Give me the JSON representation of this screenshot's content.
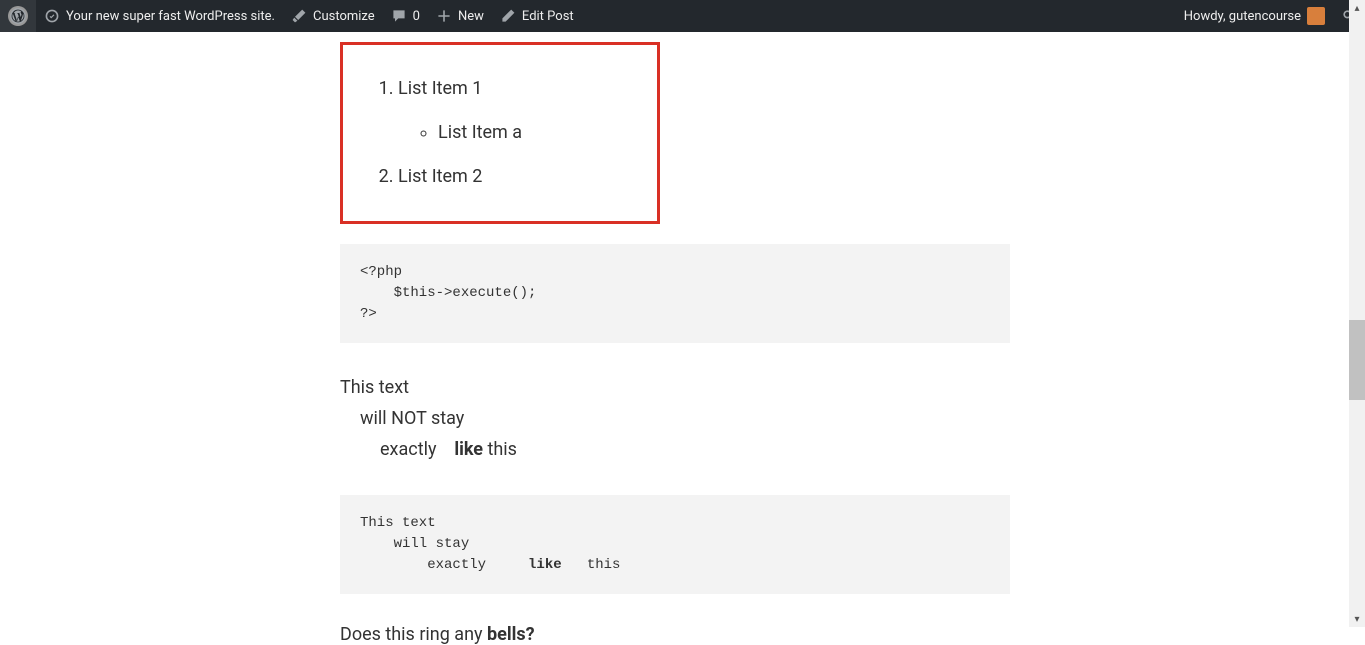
{
  "adminBar": {
    "siteName": "Your new super fast WordPress site.",
    "customize": "Customize",
    "commentsCount": "0",
    "new": "New",
    "editPost": "Edit Post",
    "greeting": "Howdy, gutencourse"
  },
  "content": {
    "list": {
      "item1": "List Item 1",
      "itemA": "List Item a",
      "item2": "List Item 2"
    },
    "codeBlock": "<?php\n    $this->execute();\n?>",
    "textBlock": {
      "line1": "This text",
      "line2": "will NOT stay",
      "line3a": "exactly",
      "line3b": "like",
      "line3c": " this"
    },
    "preBlock": {
      "line1": "This text",
      "line2": "    will stay",
      "line3a": "        exactly     ",
      "line3b": "like",
      "line3c": "   this"
    },
    "question": {
      "part1": "Does this ring any ",
      "part2": "bells?"
    }
  }
}
